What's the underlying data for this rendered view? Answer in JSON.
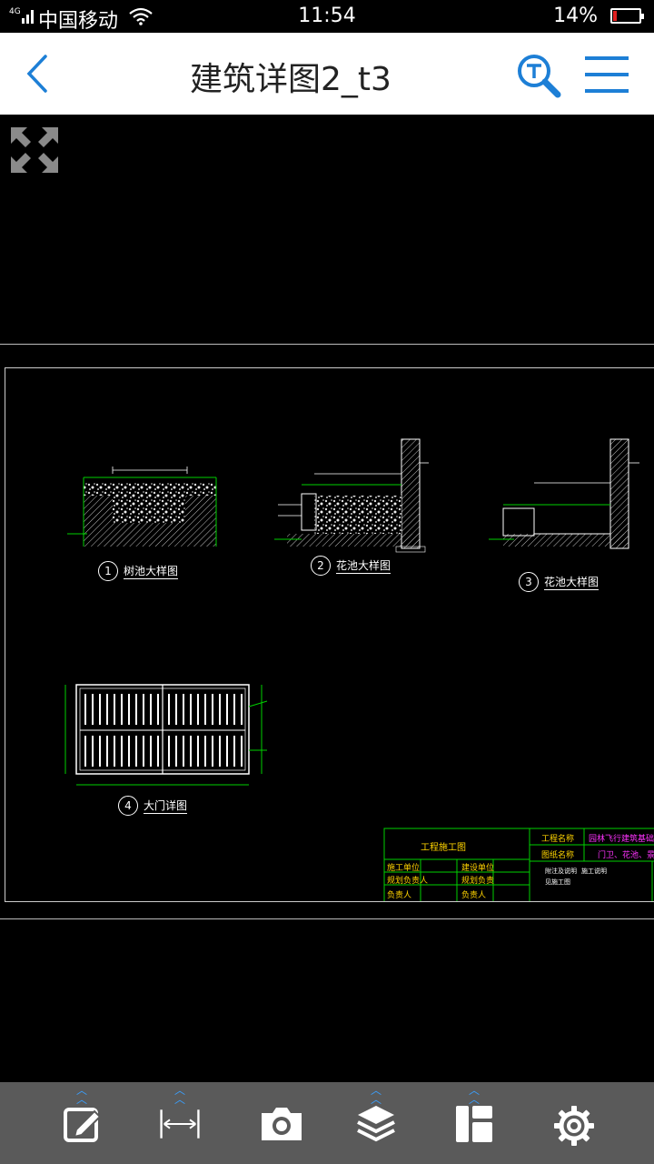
{
  "status_bar": {
    "carrier": "中国移动",
    "network": "4G",
    "time": "11:54",
    "battery": "14%",
    "battery_level": 0.14
  },
  "header": {
    "title": "建筑详图2_t3",
    "back_icon": "chevron-left-icon",
    "search_icon": "search-text-icon",
    "menu_icon": "hamburger-menu-icon"
  },
  "canvas": {
    "fullscreen_icon": "expand-arrows-icon"
  },
  "drawing": {
    "details": [
      {
        "number": "1",
        "label": "树池大样图"
      },
      {
        "number": "2",
        "label": "花池大样图"
      },
      {
        "number": "3",
        "label": "花池大样图"
      },
      {
        "number": "4",
        "label": "大门详图"
      }
    ],
    "title_block": {
      "project_type": "工程施工图",
      "rows": [
        "施工单位",
        "规划负责人",
        "负责人"
      ],
      "rows2": [
        "建设单位",
        "规划负责",
        "负责人"
      ],
      "project_label": "工程名称",
      "drawing_label": "图纸名称",
      "project_name": "园林飞行建筑基础、景观施工图",
      "drawing_name": "门卫、花池、景观详图",
      "note1": "附注及说明",
      "note2": "施工说明",
      "note3": "见施工图"
    }
  },
  "toolbar": {
    "items": [
      {
        "name": "annotate",
        "icon": "edit-icon",
        "expand": true
      },
      {
        "name": "measure",
        "icon": "measure-icon",
        "expand": true
      },
      {
        "name": "screenshot",
        "icon": "camera-icon",
        "expand": false
      },
      {
        "name": "layers",
        "icon": "layers-icon",
        "expand": true
      },
      {
        "name": "layout",
        "icon": "layout-icon",
        "expand": true
      },
      {
        "name": "settings",
        "icon": "gear-icon",
        "expand": false
      }
    ]
  },
  "colors": {
    "accent": "#1d7fd6",
    "cad_green": "#00d000",
    "cad_yellow": "#ffd400",
    "cad_magenta": "#ff33ff",
    "toolbar_bg": "#5a5a5a"
  }
}
